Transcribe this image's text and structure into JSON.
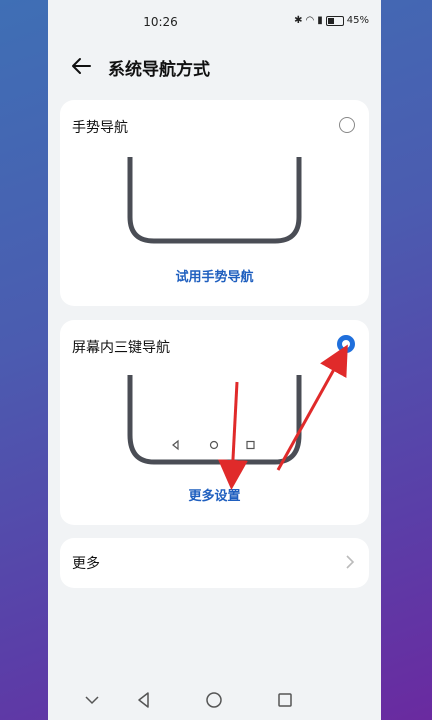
{
  "status_bar": {
    "time": "10:26",
    "battery": "45%"
  },
  "header": {
    "title": "系统导航方式"
  },
  "options": [
    {
      "label": "手势导航",
      "link": "试用手势导航",
      "selected": false
    },
    {
      "label": "屏幕内三键导航",
      "link": "更多设置",
      "selected": true
    }
  ],
  "more": {
    "label": "更多"
  },
  "colors": {
    "accent": "#1f6fdc",
    "annotation_arrow": "#e02a2a"
  }
}
